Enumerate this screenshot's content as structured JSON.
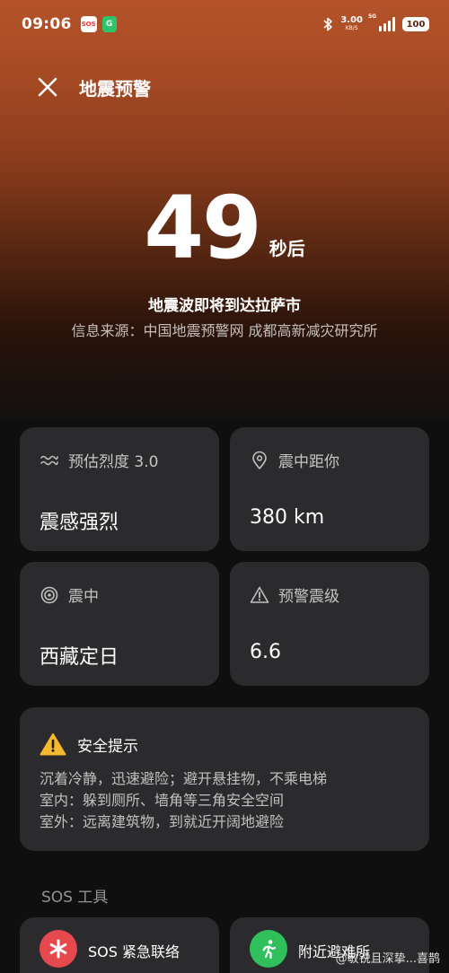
{
  "status_bar": {
    "time": "09:06",
    "sos_badge": "SOS",
    "app_badge": "G",
    "net_speed_value": "3.00",
    "net_speed_unit": "KB/S",
    "signal_label": "5G",
    "battery": "100"
  },
  "header": {
    "title": "地震预警",
    "close_icon": "close-icon"
  },
  "countdown": {
    "seconds": "49",
    "unit": "秒后"
  },
  "alert": {
    "message": "地震波即将到达拉萨市",
    "source": "信息来源：中国地震预警网 成都高新减灾研究所"
  },
  "cards": {
    "intensity": {
      "icon": "waves-icon",
      "label": "预估烈度 3.0",
      "value": "震感强烈"
    },
    "distance": {
      "icon": "location-pin-icon",
      "label": "震中距你",
      "value": "380 km"
    },
    "epicenter": {
      "icon": "target-icon",
      "label": "震中",
      "value": "西藏定日"
    },
    "magnitude": {
      "icon": "warning-triangle-icon",
      "label": "预警震级",
      "value": "6.6"
    }
  },
  "safety_tips": {
    "icon": "warning-icon",
    "title": "安全提示",
    "lines": [
      "沉着冷静，迅速避险；避开悬挂物，不乘电梯",
      "室内：躲到厕所、墙角等三角安全空间",
      "室外：远离建筑物，到就近开阔地避险"
    ]
  },
  "sos_tools": {
    "section_label": "SOS 工具",
    "items": [
      {
        "icon": "asterisk-emergency-icon",
        "label": "SOS 紧急联络",
        "color": "#e5484d"
      },
      {
        "icon": "running-person-icon",
        "label": "附近避难所",
        "color": "#2fbf5b"
      }
    ]
  },
  "watermark": "@敏锐且深挚...喜鹊",
  "colors": {
    "gradient_top": "#b4532b",
    "background": "#0f0f10",
    "card": "#2b2b2d",
    "warning_yellow": "#f5b82e"
  }
}
